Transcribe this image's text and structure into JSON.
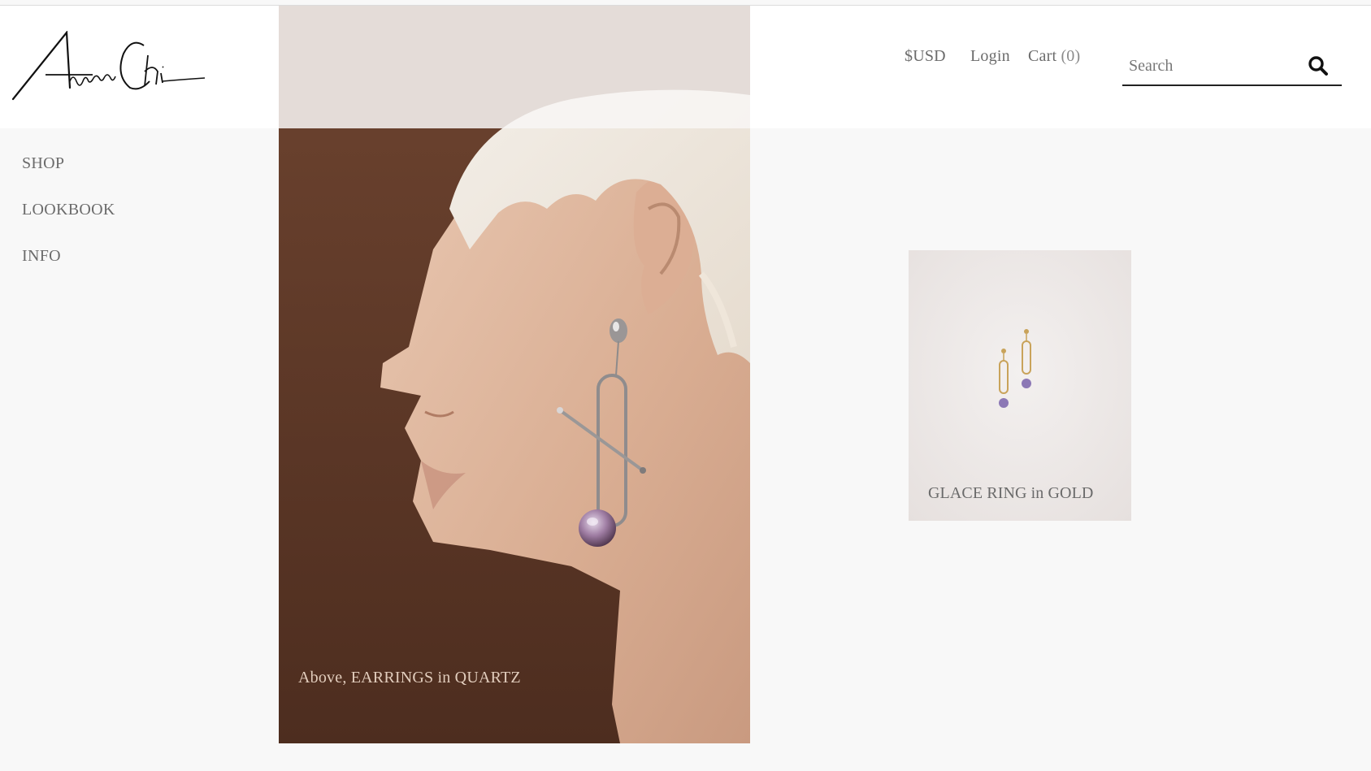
{
  "brand": {
    "logo_name": "Aurora Chi"
  },
  "topnav": {
    "currency": "$USD",
    "login": "Login",
    "cart_label": "Cart",
    "cart_count": "(0)"
  },
  "search": {
    "placeholder": "Search"
  },
  "sidenav": {
    "items": [
      {
        "label": "SHOP"
      },
      {
        "label": "LOOKBOOK"
      },
      {
        "label": "INFO"
      }
    ]
  },
  "hero": {
    "caption": "Above, EARRINGS in QUARTZ"
  },
  "product": {
    "title": "GLACE RING in GOLD"
  },
  "icons": {
    "search": "search-icon"
  },
  "colors": {
    "header_bg": "#ffffff",
    "page_bg": "#f8f8f8",
    "hero_backdrop": "#5e3a28",
    "nav_text": "#6b6b6b",
    "search_underline": "#222222"
  }
}
